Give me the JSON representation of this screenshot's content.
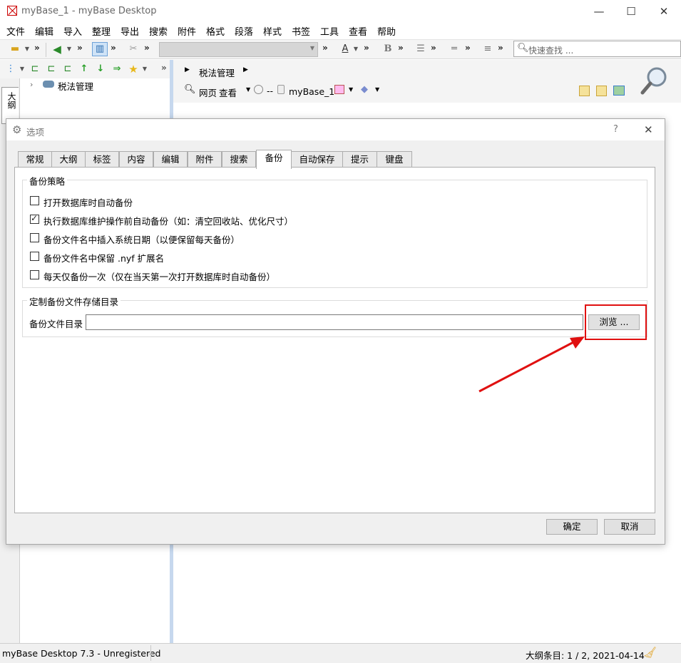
{
  "window": {
    "title": "myBase_1 - myBase Desktop",
    "controls": [
      "—",
      "☐",
      "✕"
    ]
  },
  "menu": [
    "文件",
    "编辑",
    "导入",
    "整理",
    "导出",
    "搜索",
    "附件",
    "格式",
    "段落",
    "样式",
    "书签",
    "工具",
    "查看",
    "帮助"
  ],
  "toolbar": {
    "chevron": "»",
    "font_color_glyph": "A",
    "bold_glyph": "B",
    "search_placeholder": "快速查找 ..."
  },
  "left_panel": {
    "vertical_tab": "大纲",
    "tree_item": "税法管理"
  },
  "right_panel": {
    "breadcrumb": "税法管理",
    "view_label": "网页",
    "view_mode": "查看",
    "dash": "--",
    "db_name": "myBase_1"
  },
  "dialog": {
    "title": "选项",
    "help": "?",
    "close": "✕",
    "tabs": [
      "常规",
      "大纲",
      "标签",
      "内容",
      "编辑",
      "附件",
      "搜索",
      "备份",
      "自动保存",
      "提示",
      "键盘"
    ],
    "active_tab": "备份",
    "backup_group": {
      "caption": "备份策略",
      "options": [
        {
          "label": "打开数据库时自动备份",
          "checked": false
        },
        {
          "label": "执行数据库维护操作前自动备份（如：清空回收站、优化尺寸）",
          "checked": true
        },
        {
          "label": "备份文件名中插入系统日期（以便保留每天备份）",
          "checked": false
        },
        {
          "label": "备份文件名中保留 .nyf 扩展名",
          "checked": false
        },
        {
          "label": "每天仅备份一次（仅在当天第一次打开数据库时自动备份）",
          "checked": false
        }
      ]
    },
    "dir_group": {
      "caption": "定制备份文件存储目录",
      "field_label": "备份文件目录",
      "field_value": "",
      "browse_label": "浏览 ..."
    },
    "ok_label": "确定",
    "cancel_label": "取消"
  },
  "status": {
    "left": "myBase Desktop 7.3 - Unregistered",
    "right": "大纲条目: 1 / 2, 2021-04-14"
  },
  "colors": {
    "accent_red": "#e01010",
    "splitter": "#c6d8ee"
  }
}
